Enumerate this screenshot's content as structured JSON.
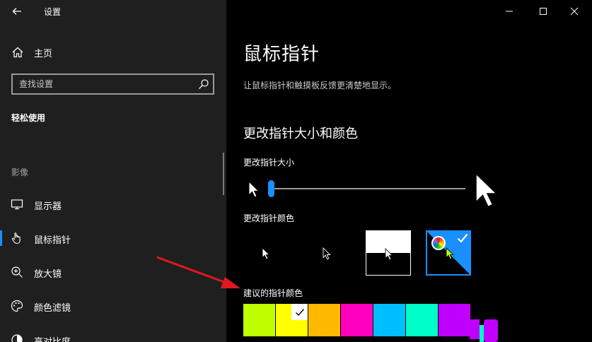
{
  "window": {
    "title": "设置",
    "controls": [
      "minimize",
      "maximize",
      "close"
    ]
  },
  "nav": {
    "home_label": "主页",
    "search_placeholder": "查找设置",
    "category": "轻松使用",
    "section_heading": "影像",
    "items": [
      {
        "label": "显示器",
        "icon": "monitor-icon",
        "active": false
      },
      {
        "label": "鼠标指针",
        "icon": "pointer-hand-icon",
        "active": true
      },
      {
        "label": "放大镜",
        "icon": "magnifier-icon",
        "active": false
      },
      {
        "label": "颜色滤镜",
        "icon": "palette-icon",
        "active": false
      },
      {
        "label": "高对比度",
        "icon": "contrast-icon",
        "active": false
      }
    ]
  },
  "main": {
    "title": "鼠标指针",
    "description": "让鼠标指针和触摸板反馈更清楚地显示。",
    "subtitle": "更改指针大小和颜色",
    "size_label": "更改指针大小",
    "size_value": 0.01,
    "color_label": "更改指针颜色",
    "color_styles": [
      {
        "name": "white",
        "selected": false
      },
      {
        "name": "black",
        "selected": false
      },
      {
        "name": "inverted",
        "selected": false
      },
      {
        "name": "custom",
        "selected": true
      }
    ],
    "suggested_label": "建议的指针颜色",
    "suggested_colors": [
      "#bfff00",
      "#ffff00",
      "#ffb900",
      "#ff00bf",
      "#00bfff",
      "#00ffc8",
      "#bf00ff"
    ],
    "selected_suggested_index": 1,
    "accent": "#1a8fff"
  }
}
